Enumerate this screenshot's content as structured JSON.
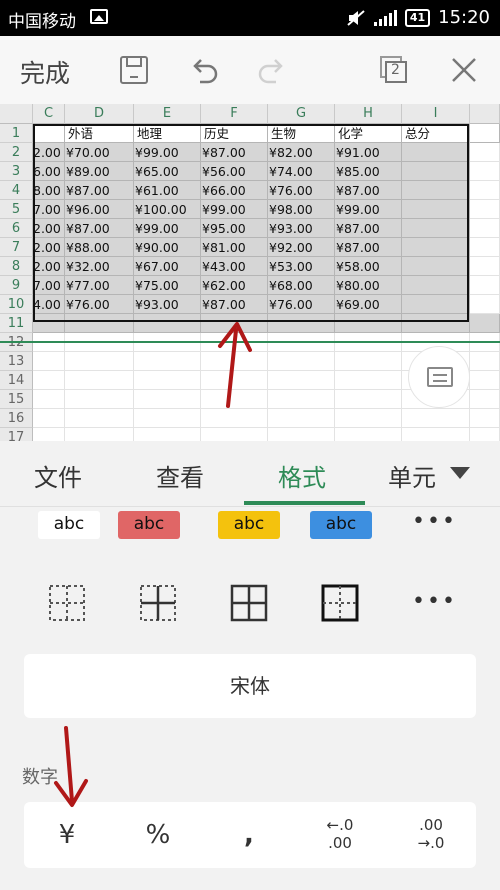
{
  "status_bar": {
    "carrier": "中国移动",
    "battery": "41",
    "time": "15:20"
  },
  "toolbar": {
    "done_label": "完成",
    "window_count": "2"
  },
  "sheet": {
    "column_headers": [
      "C",
      "D",
      "E",
      "F",
      "G",
      "H",
      "I"
    ],
    "row_headers": [
      "1",
      "2",
      "3",
      "4",
      "5",
      "6",
      "7",
      "8",
      "9",
      "10",
      "11",
      "12",
      "13",
      "14",
      "15",
      "16",
      "17"
    ],
    "header_row": [
      "",
      "外语",
      "地理",
      "历史",
      "生物",
      "化学",
      "总分"
    ],
    "rows": [
      [
        "2.00",
        "¥70.00",
        "¥99.00",
        "¥87.00",
        "¥82.00",
        "¥91.00",
        ""
      ],
      [
        "6.00",
        "¥89.00",
        "¥65.00",
        "¥56.00",
        "¥74.00",
        "¥85.00",
        ""
      ],
      [
        "8.00",
        "¥87.00",
        "¥61.00",
        "¥66.00",
        "¥76.00",
        "¥87.00",
        ""
      ],
      [
        "7.00",
        "¥96.00",
        "¥100.00",
        "¥99.00",
        "¥98.00",
        "¥99.00",
        ""
      ],
      [
        "2.00",
        "¥87.00",
        "¥99.00",
        "¥95.00",
        "¥93.00",
        "¥87.00",
        ""
      ],
      [
        "2.00",
        "¥88.00",
        "¥90.00",
        "¥81.00",
        "¥92.00",
        "¥87.00",
        ""
      ],
      [
        "2.00",
        "¥32.00",
        "¥67.00",
        "¥43.00",
        "¥53.00",
        "¥58.00",
        ""
      ],
      [
        "7.00",
        "¥77.00",
        "¥75.00",
        "¥62.00",
        "¥68.00",
        "¥80.00",
        ""
      ],
      [
        "4.00",
        "¥76.00",
        "¥93.00",
        "¥87.00",
        "¥76.00",
        "¥69.00",
        ""
      ]
    ]
  },
  "tabs": [
    {
      "label": "文件",
      "active": false
    },
    {
      "label": "查看",
      "active": false
    },
    {
      "label": "格式",
      "active": true
    },
    {
      "label": "单元",
      "active": false
    }
  ],
  "format_panel": {
    "text_styles": [
      {
        "label": "abc",
        "bg": "#ffffff"
      },
      {
        "label": "abc",
        "bg": "#e06666"
      },
      {
        "label": "abc",
        "bg": "#f4c20d"
      },
      {
        "label": "abc",
        "bg": "#3d8fe0"
      }
    ],
    "more_label": "•••",
    "font_name": "宋体",
    "number_section_label": "数字",
    "number_buttons": [
      "¥",
      "%",
      ",",
      ".0←.00",
      ".00→.0"
    ]
  },
  "colors": {
    "accent": "#2e8b57",
    "arrow": "#b01818"
  }
}
